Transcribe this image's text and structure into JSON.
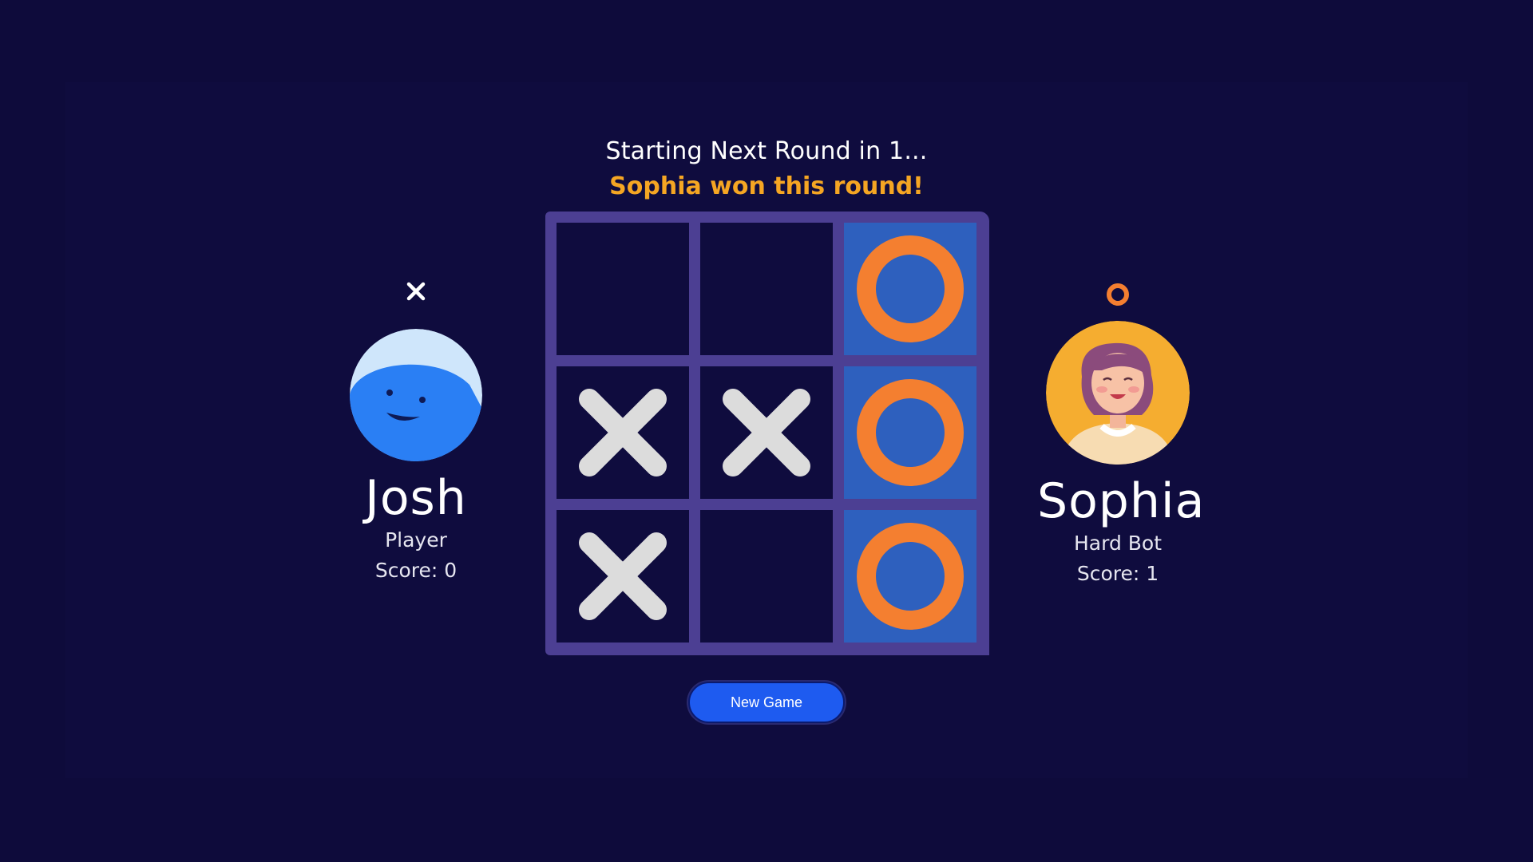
{
  "status": {
    "countdown": "Starting Next Round in 1...",
    "winner_message": "Sophia won this round!"
  },
  "players": {
    "josh": {
      "symbol": "X",
      "symbol_icon": "x-icon",
      "name": "Josh",
      "role": "Player",
      "score": "Score: 0",
      "avatar": "blue-smiley-avatar"
    },
    "sophia": {
      "symbol": "O",
      "symbol_icon": "o-icon",
      "name": "Sophia",
      "role": "Hard Bot",
      "score": "Score: 1",
      "avatar": "woman-avatar"
    }
  },
  "board": {
    "cells": [
      "",
      "",
      "O",
      "X",
      "X",
      "O",
      "X",
      "",
      "O"
    ],
    "winning_cells": [
      2,
      5,
      8
    ]
  },
  "controls": {
    "new_game_label": "New Game"
  },
  "colors": {
    "background": "#0e0b3b",
    "grid": "#4c3f93",
    "win_highlight": "#2e60be",
    "x_mark": "#dcdcdc",
    "o_mark": "#f47f30",
    "winner_text": "#f5a623",
    "button": "#1e5bf0"
  }
}
